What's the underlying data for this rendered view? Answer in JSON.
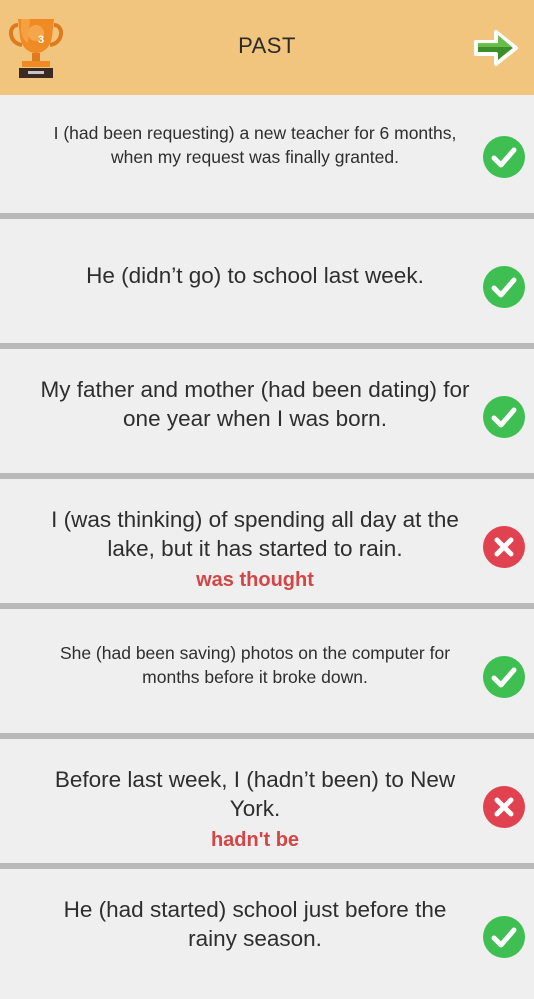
{
  "header": {
    "title": "PAST",
    "trophy_count": "3",
    "next_icon": "arrow-right-icon"
  },
  "colors": {
    "header_bg": "#f1c57d",
    "correct": "#3fbf52",
    "incorrect": "#e0434f",
    "correction_text": "#d64545"
  },
  "items": [
    {
      "sentence": "I (had been requesting) a new teacher for 6 months, when my request was finally granted.",
      "status": "correct",
      "correction": ""
    },
    {
      "sentence": "He (didn’t go) to school last week.",
      "status": "correct",
      "correction": ""
    },
    {
      "sentence": "My father and mother (had been dating) for one year when I was born.",
      "status": "correct",
      "correction": ""
    },
    {
      "sentence": "I (was thinking) of spending all day at the lake, but it has started to rain.",
      "status": "incorrect",
      "correction": "was thought"
    },
    {
      "sentence": "She (had been saving) photos on the computer for months before it broke down.",
      "status": "correct",
      "correction": ""
    },
    {
      "sentence": "Before last week, I (hadn’t been) to New York.",
      "status": "incorrect",
      "correction": "hadn't be"
    },
    {
      "sentence": "He (had started) school just before the rainy season.",
      "status": "correct",
      "correction": ""
    }
  ]
}
